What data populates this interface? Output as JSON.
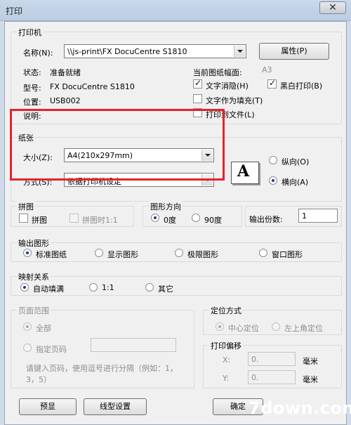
{
  "window": {
    "title": "打印",
    "close_label": "✕"
  },
  "printer": {
    "group_label": "打印机",
    "name_label": "名称(N):",
    "name_value": "\\\\js-print\\FX DocuCentre S1810",
    "properties_button": "属性(P)",
    "status_label": "状态:",
    "status_value": "准备就绪",
    "type_label": "型号:",
    "type_value": "FX DocuCentre S1810",
    "location_label": "位置:",
    "location_value": "USB002",
    "comment_label": "说明:",
    "paper_size_label": "当前图纸幅面:",
    "paper_size_value": "A3",
    "text_hidden_label": "文字消隐(H)",
    "text_hidden_checked": true,
    "bw_print_label": "黑白打印(B)",
    "bw_print_checked": true,
    "text_fill_label": "文字作为填充(T)",
    "text_fill_checked": false,
    "print_to_file_label": "打印到文件(L)",
    "print_to_file_checked": false
  },
  "paper": {
    "group_label": "纸张",
    "size_label": "大小(Z):",
    "size_value": "A4(210x297mm)",
    "method_label": "方式(S):",
    "method_value": "依据打印机设定",
    "orientation_letter": "A",
    "portrait_label": "纵向(O)",
    "landscape_label": "横向(A)",
    "orientation_selected": "landscape"
  },
  "tiling": {
    "group_label": "拼图",
    "tile_label": "拼图",
    "tile_checked": false,
    "tile_ratio_label": "拼图时1:1"
  },
  "direction": {
    "group_label": "图形方向",
    "deg0_label": "0度",
    "deg90_label": "90度",
    "selected": "0"
  },
  "copies": {
    "label": "输出份数:",
    "value": "1"
  },
  "output": {
    "group_label": "输出图形",
    "options": [
      "标准图纸",
      "显示图形",
      "极限图形",
      "窗口图形"
    ],
    "selected": 0
  },
  "mapping": {
    "group_label": "映射关系",
    "options": [
      "自动填满",
      "1:1",
      "其它"
    ],
    "selected": 0
  },
  "page_range": {
    "group_label": "页面范围",
    "all_label": "全部",
    "specific_label": "指定页码",
    "hint": "请键入页码，使用逗号进行分隔（例如：1，3，5）"
  },
  "position": {
    "group_label": "定位方式",
    "center_label": "中心定位",
    "topleft_label": "左上角定位",
    "selected": "center"
  },
  "offset": {
    "group_label": "打印偏移",
    "x_label": "X:",
    "x_value": "0.",
    "y_label": "Y:",
    "y_value": "0.",
    "unit": "毫米"
  },
  "footer": {
    "preview_button": "预显",
    "line_button": "线型设置",
    "ok_button": "确定"
  },
  "watermark": "7down.com"
}
